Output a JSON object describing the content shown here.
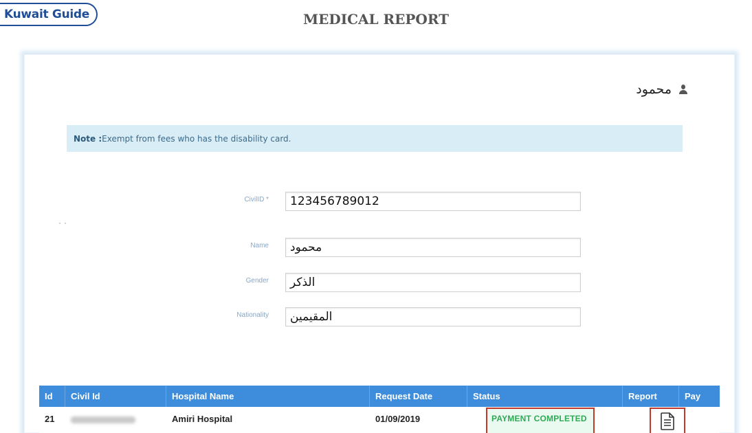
{
  "logo": {
    "text": "Kuwait Guide"
  },
  "page": {
    "title": "MEDICAL REPORT"
  },
  "user": {
    "name": "محمود"
  },
  "note": {
    "label": "Note :",
    "text": "Exempt from fees who has the disability card."
  },
  "form": {
    "civil_id": {
      "label": "CivilID *",
      "value": "123456789012"
    },
    "name": {
      "label": "Name",
      "value": "محمود"
    },
    "gender": {
      "label": "Gender",
      "value": "الذكر"
    },
    "nationality": {
      "label": "Nationality",
      "value": "المقيمين"
    }
  },
  "table": {
    "headers": [
      "Id",
      "Civil Id",
      "Hospital Name",
      "Request Date",
      "Status",
      "Report",
      "Pay"
    ],
    "rows": [
      {
        "id": "21",
        "hospital": "Amiri Hospital",
        "date": "01/09/2019",
        "status": "PAYMENT COMPLETED"
      }
    ]
  },
  "colors": {
    "header_blue": "#3d8ddc",
    "status_green": "#2eaa55",
    "highlight_red": "#c0392b",
    "note_bg": "#d9edf7"
  },
  "icons": {
    "user": "user-icon",
    "report": "document-icon"
  }
}
